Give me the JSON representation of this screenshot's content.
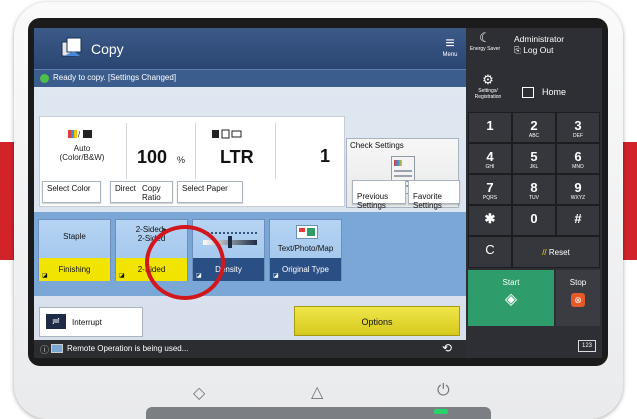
{
  "app": {
    "title": "Copy"
  },
  "menu": {
    "label": "Menu"
  },
  "status": {
    "text": "Ready to copy. [Settings Changed]"
  },
  "settings": {
    "color": {
      "value": "Auto\n(Color/B&W)"
    },
    "ratio": {
      "value": "100",
      "unit": "%"
    },
    "paper": {
      "value": "LTR"
    },
    "copies": {
      "value": "1"
    },
    "check_settings": "Check Settings"
  },
  "buttons": {
    "select_color": "Select Color",
    "direct": "Direct",
    "copy_ratio": "Copy\nRatio",
    "select_paper": "Select Paper",
    "previous_settings": "Previous\nSettings",
    "favorite_settings": "Favorite\nSettings"
  },
  "functions": [
    {
      "top": "Staple",
      "bottom": "Finishing"
    },
    {
      "top": "2-Sided▸\n2-Sided",
      "bottom": "2-Sided"
    },
    {
      "top": "",
      "bottom": "Density"
    },
    {
      "top": "Text/Photo/Map",
      "bottom": "Original Type"
    }
  ],
  "interrupt": {
    "label": "Interrupt"
  },
  "options": {
    "label": "Options"
  },
  "footer": {
    "text": "Remote Operation is being used..."
  },
  "right": {
    "energy_saver": "Energy Saver",
    "admin_name": "Administrator",
    "logout": "Log Out",
    "settings_registration": "Settings/\nRegistration",
    "home": "Home",
    "keys": [
      {
        "digit": "1",
        "sub": ""
      },
      {
        "digit": "2",
        "sub": "ABC"
      },
      {
        "digit": "3",
        "sub": "DEF"
      },
      {
        "digit": "4",
        "sub": "GHI"
      },
      {
        "digit": "5",
        "sub": "JKL"
      },
      {
        "digit": "6",
        "sub": "MNO"
      },
      {
        "digit": "7",
        "sub": "PQRS"
      },
      {
        "digit": "8",
        "sub": "TUV"
      },
      {
        "digit": "9",
        "sub": "WXYZ"
      },
      {
        "digit": "✱",
        "sub": ""
      },
      {
        "digit": "0",
        "sub": ""
      },
      {
        "digit": "#",
        "sub": ""
      }
    ],
    "clear": "C",
    "reset": "Reset",
    "start": "Start",
    "stop": "Stop",
    "counter": "123"
  }
}
